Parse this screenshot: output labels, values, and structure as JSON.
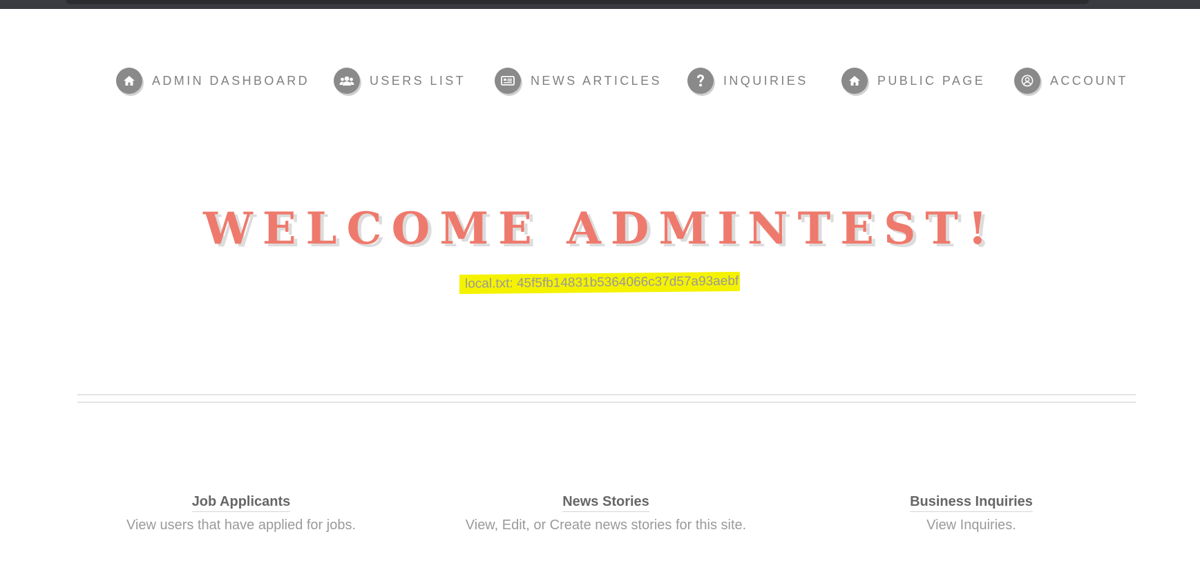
{
  "nav": {
    "items": [
      {
        "label": "ADMIN DASHBOARD",
        "icon": "home-icon"
      },
      {
        "label": "USERS LIST",
        "icon": "users-icon"
      },
      {
        "label": "NEWS ARTICLES",
        "icon": "newspaper-icon"
      },
      {
        "label": "INQUIRIES",
        "icon": "question-icon"
      },
      {
        "label": "PUBLIC PAGE",
        "icon": "home-icon"
      },
      {
        "label": "ACCOUNT",
        "icon": "user-circle-icon"
      }
    ]
  },
  "hero": {
    "title": "WELCOME ADMINTEST!",
    "flag": "local.txt: 45f5fb14831b5364066c37d57a93aebf"
  },
  "cards": [
    {
      "title": "Job Applicants",
      "description": "View users that have applied for jobs."
    },
    {
      "title": "News Stories",
      "description": "View, Edit, or Create news stories for this site."
    },
    {
      "title": "Business Inquiries",
      "description": "View Inquiries."
    }
  ],
  "colors": {
    "accent": "#ee7a6d",
    "icon_bg": "#8a8a8a",
    "highlight": "#f5f200",
    "nav_text": "#808080"
  }
}
